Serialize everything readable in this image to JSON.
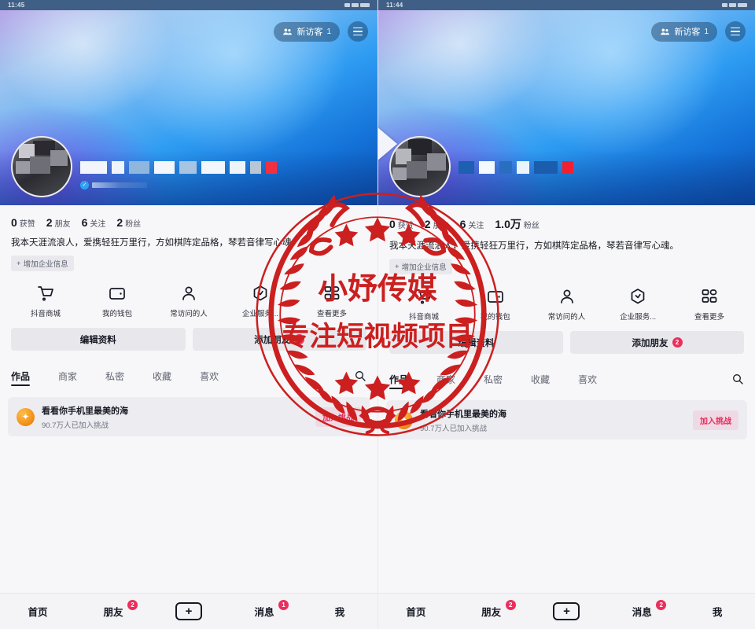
{
  "panels": [
    {
      "id": "left",
      "statusbar": {
        "clock": "11:45"
      },
      "cover": {
        "visitor_label": "新访客",
        "visitor_count": "1",
        "menu_icon": "hamburger-menu-icon",
        "visitor_icon": "people-icon"
      },
      "stats": [
        {
          "num": "0",
          "label": "获赞"
        },
        {
          "num": "2",
          "label": "朋友"
        },
        {
          "num": "6",
          "label": "关注"
        },
        {
          "num": "2",
          "label": "粉丝"
        }
      ],
      "bio": "我本天涯流浪人，爱携轻狂万里行，方如棋阵定品格，琴若音律写心魂。",
      "biz_chip": "增加企业信息",
      "quick_actions": [
        {
          "label": "抖音商城",
          "icon": "cart-icon"
        },
        {
          "label": "我的钱包",
          "icon": "wallet-icon"
        },
        {
          "label": "常访问的人",
          "icon": "person-icon"
        },
        {
          "label": "企业服务...",
          "icon": "cube-icon"
        },
        {
          "label": "查看更多",
          "icon": "grid-icon"
        }
      ],
      "actions": [
        {
          "label": "编辑资料",
          "badge": ""
        },
        {
          "label": "添加朋友",
          "badge": "2"
        }
      ],
      "tabs": [
        {
          "label": "作品",
          "active": true
        },
        {
          "label": "商家",
          "active": false
        },
        {
          "label": "私密",
          "active": false
        },
        {
          "label": "收藏",
          "active": false
        },
        {
          "label": "喜欢",
          "active": false
        }
      ],
      "search_icon": "search-icon",
      "challenge": {
        "icon": "challenge-star-icon",
        "title": "看看你手机里最美的海",
        "subtitle": "90.7万人已加入挑战",
        "join_label": "加入挑战"
      },
      "bottom_nav": [
        {
          "label": "首页",
          "badge": ""
        },
        {
          "label": "朋友",
          "badge": "2"
        },
        {
          "label": "+",
          "badge": "",
          "type": "plus"
        },
        {
          "label": "消息",
          "badge": "1"
        },
        {
          "label": "我",
          "badge": ""
        }
      ]
    },
    {
      "id": "right",
      "statusbar": {
        "clock": "11:44"
      },
      "cover": {
        "visitor_label": "新访客",
        "visitor_count": "1",
        "menu_icon": "hamburger-menu-icon",
        "visitor_icon": "people-icon"
      },
      "stats": [
        {
          "num": "0",
          "label": "获赞"
        },
        {
          "num": "2",
          "label": "朋友"
        },
        {
          "num": "6",
          "label": "关注"
        },
        {
          "num": "1.0万",
          "label": "粉丝"
        }
      ],
      "bio": "我本天涯流浪人，爱携轻狂万里行，方如棋阵定品格，琴若音律写心魂。",
      "biz_chip": "增加企业信息",
      "quick_actions": [
        {
          "label": "抖音商城",
          "icon": "cart-icon"
        },
        {
          "label": "我的钱包",
          "icon": "wallet-icon"
        },
        {
          "label": "常访问的人",
          "icon": "person-icon"
        },
        {
          "label": "企业服务...",
          "icon": "cube-icon"
        },
        {
          "label": "查看更多",
          "icon": "grid-icon"
        }
      ],
      "actions": [
        {
          "label": "编辑资料",
          "badge": ""
        },
        {
          "label": "添加朋友",
          "badge": "2"
        }
      ],
      "tabs": [
        {
          "label": "作品",
          "active": true
        },
        {
          "label": "商家",
          "active": false
        },
        {
          "label": "私密",
          "active": false
        },
        {
          "label": "收藏",
          "active": false
        },
        {
          "label": "喜欢",
          "active": false
        }
      ],
      "search_icon": "search-icon",
      "challenge": {
        "icon": "challenge-star-icon",
        "title": "看看你手机里最美的海",
        "subtitle": "90.7万人已加入挑战",
        "join_label": "加入挑战"
      },
      "bottom_nav": [
        {
          "label": "首页",
          "badge": ""
        },
        {
          "label": "朋友",
          "badge": "2"
        },
        {
          "label": "+",
          "badge": "",
          "type": "plus"
        },
        {
          "label": "消息",
          "badge": "2"
        },
        {
          "label": "我",
          "badge": ""
        }
      ]
    }
  ],
  "watermark": {
    "line1": "小妤传媒",
    "line2": "专注短视频项目",
    "color": "#cc1f1f"
  },
  "colors": {
    "accent_red": "#ec2e5b",
    "join_red": "#e8285a",
    "text_primary": "#161823",
    "text_secondary": "#70737f",
    "panel_bg": "#f7f7f9",
    "button_bg": "#e8e8ec"
  }
}
